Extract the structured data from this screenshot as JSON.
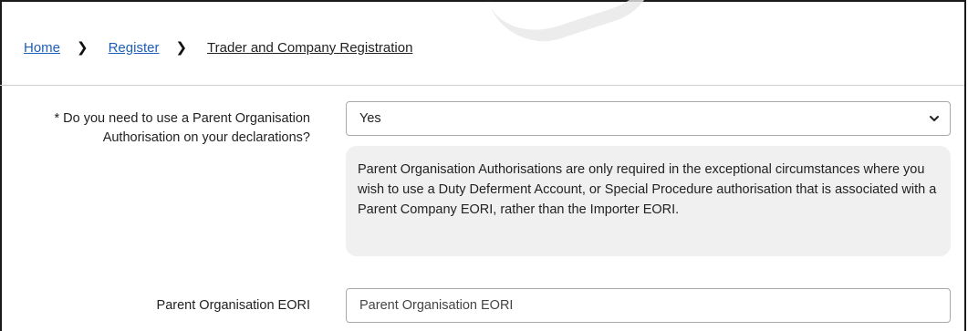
{
  "breadcrumb": {
    "home": "Home",
    "register": "Register",
    "current": "Trader and Company Registration",
    "separator": "❯"
  },
  "form": {
    "parent_auth_question": "* Do you need to use a Parent Organisation Authorisation on your declarations?",
    "parent_auth_value": "Yes",
    "parent_auth_help": "Parent Organisation Authorisations are only required in the exceptional circumstances where you wish to use a Duty Deferment Account, or Special Procedure authorisation that is associated with a Parent Company EORI, rather than the Importer EORI.",
    "eori_label": "Parent Organisation EORI",
    "eori_placeholder": "Parent Organisation EORI",
    "eori_value": ""
  },
  "colors": {
    "link": "#1d5fb8",
    "help_bg": "#f0f0f0",
    "border": "#a9a9a9"
  }
}
